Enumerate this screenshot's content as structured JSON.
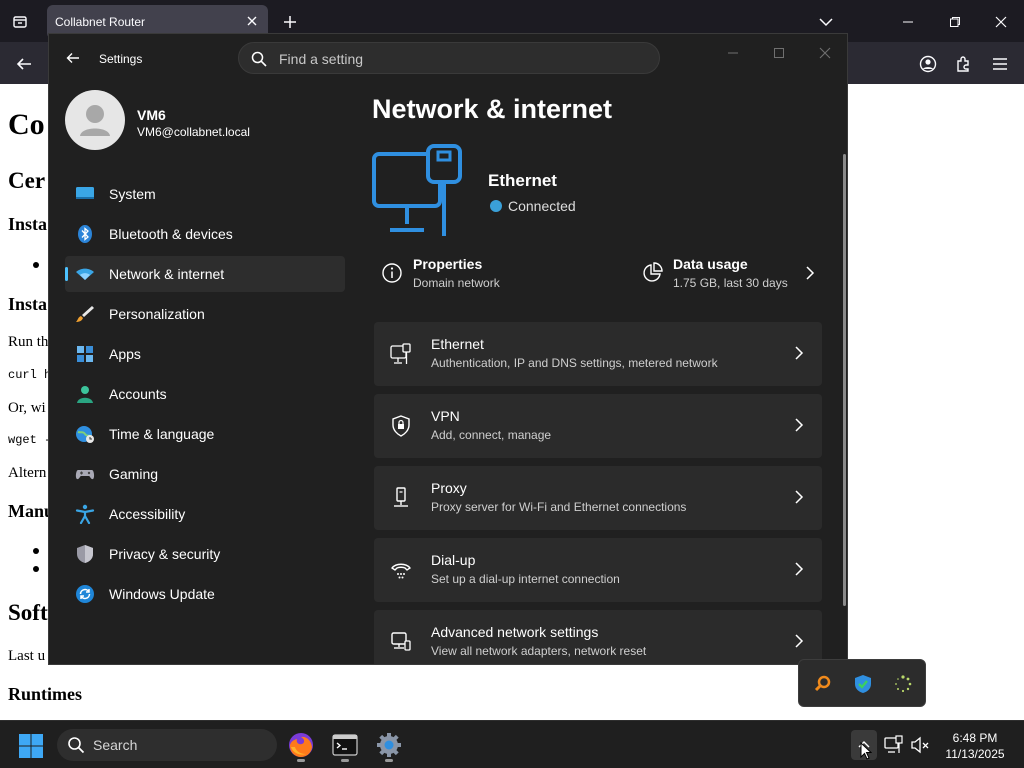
{
  "browser": {
    "tab_title": "Collabnet Router"
  },
  "webpage": {
    "h1": "Co",
    "h2": "Cer",
    "h3a": "Insta",
    "h3b": "Insta",
    "p1": "Run th",
    "code1": "curl h",
    "p2": "Or, wi",
    "code2": "wget -",
    "p3": "Altern",
    "h3c": "Manu",
    "h2b": "Softw",
    "p4": "Last u",
    "h3d": "Runtimes"
  },
  "settings": {
    "window_title": "Settings",
    "search_placeholder": "Find a setting",
    "user": {
      "name": "VM6",
      "email": "VM6@collabnet.local"
    },
    "nav": [
      {
        "label": "System",
        "icon": "monitor-icon"
      },
      {
        "label": "Bluetooth & devices",
        "icon": "bluetooth-icon"
      },
      {
        "label": "Network & internet",
        "icon": "wifi-icon"
      },
      {
        "label": "Personalization",
        "icon": "brush-icon"
      },
      {
        "label": "Apps",
        "icon": "apps-icon"
      },
      {
        "label": "Accounts",
        "icon": "person-icon"
      },
      {
        "label": "Time & language",
        "icon": "globe-clock-icon"
      },
      {
        "label": "Gaming",
        "icon": "gamepad-icon"
      },
      {
        "label": "Accessibility",
        "icon": "accessibility-icon"
      },
      {
        "label": "Privacy & security",
        "icon": "shield-icon"
      },
      {
        "label": "Windows Update",
        "icon": "refresh-icon"
      }
    ],
    "active_nav_index": 2,
    "page_title": "Network & internet",
    "hero": {
      "name": "Ethernet",
      "status": "Connected"
    },
    "properties": {
      "title": "Properties",
      "sub": "Domain network"
    },
    "data_usage": {
      "title": "Data usage",
      "sub": "1.75 GB, last 30 days"
    },
    "cards": [
      {
        "title": "Ethernet",
        "sub": "Authentication, IP and DNS settings, metered network",
        "icon": "ethernet-icon"
      },
      {
        "title": "VPN",
        "sub": "Add, connect, manage",
        "icon": "vpn-shield-icon"
      },
      {
        "title": "Proxy",
        "sub": "Proxy server for Wi-Fi and Ethernet connections",
        "icon": "proxy-icon"
      },
      {
        "title": "Dial-up",
        "sub": "Set up a dial-up internet connection",
        "icon": "dialup-icon"
      },
      {
        "title": "Advanced network settings",
        "sub": "View all network adapters, network reset",
        "icon": "advanced-network-icon"
      }
    ]
  },
  "taskbar": {
    "search_label": "Search",
    "time": "6:48 PM",
    "date": "11/13/2025"
  },
  "colors": {
    "accent": "#4cc2ff",
    "window_bg": "#202020",
    "card_bg": "#2b2b2b",
    "taskbar_bg": "#1f1f1f"
  }
}
